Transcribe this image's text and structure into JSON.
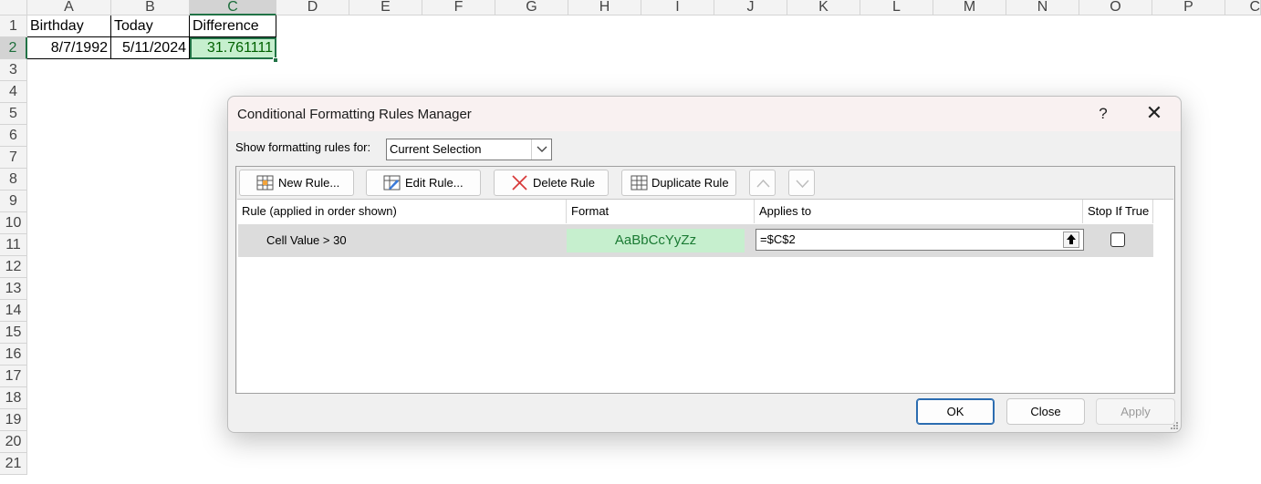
{
  "sheet": {
    "columns": [
      "A",
      "B",
      "C",
      "D",
      "E",
      "F",
      "G",
      "H",
      "I",
      "J",
      "K",
      "L",
      "M",
      "N",
      "O",
      "P",
      "C"
    ],
    "rows": [
      "1",
      "2",
      "3",
      "4",
      "5",
      "6",
      "7",
      "8",
      "9",
      "10",
      "11",
      "12",
      "13",
      "14",
      "15",
      "16",
      "17",
      "18",
      "19",
      "20",
      "21"
    ],
    "headers": {
      "a1": "Birthday",
      "b1": "Today",
      "c1": "Difference"
    },
    "values": {
      "a2": "8/7/1992",
      "b2": "5/11/2024",
      "c2": "31.761111"
    }
  },
  "dialog": {
    "title": "Conditional Formatting Rules Manager",
    "help": "?",
    "close_glyph": "✕",
    "show_label": "Show formatting rules for:",
    "show_value": "Current Selection",
    "toolbar": {
      "new_rule": "New Rule...",
      "edit_rule": "Edit Rule...",
      "delete_rule": "Delete Rule",
      "duplicate_rule": "Duplicate Rule"
    },
    "table_headers": [
      "Rule (applied in order shown)",
      "Format",
      "Applies to",
      "Stop If True"
    ],
    "rule": {
      "name": "Cell Value > 30",
      "preview": "AaBbCcYyZz",
      "applies_to": "=$C$2",
      "stop_if_true": false
    },
    "buttons": {
      "ok": "OK",
      "close": "Close",
      "apply": "Apply"
    }
  },
  "colors": {
    "accent": "#217346",
    "highlight_fill": "#c6efce",
    "highlight_text": "#006100",
    "ok_border": "#2b6cb0"
  }
}
